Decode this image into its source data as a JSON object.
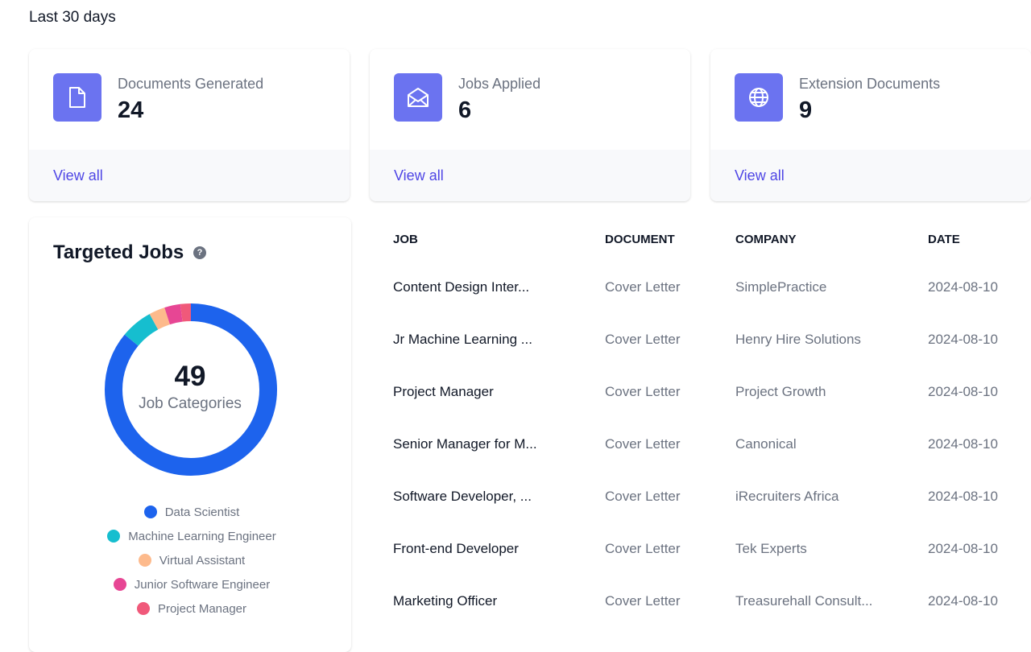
{
  "period": "Last 30 days",
  "stats": [
    {
      "label": "Documents Generated",
      "value": "24",
      "link": "View all",
      "icon": "document-icon"
    },
    {
      "label": "Jobs Applied",
      "value": "6",
      "link": "View all",
      "icon": "envelope-open-icon"
    },
    {
      "label": "Extension Documents",
      "value": "9",
      "link": "View all",
      "icon": "globe-icon"
    }
  ],
  "targeted": {
    "title": "Targeted Jobs",
    "help": "?",
    "center_value": "49",
    "center_label": "Job Categories",
    "categories": [
      {
        "name": "Data Scientist",
        "color": "#1D63ED"
      },
      {
        "name": "Machine Learning Engineer",
        "color": "#16BECF"
      },
      {
        "name": "Virtual Assistant",
        "color": "#FDBA8C"
      },
      {
        "name": "Junior Software Engineer",
        "color": "#E74694"
      },
      {
        "name": "Project Manager",
        "color": "#F0597A"
      }
    ],
    "segment_fractions": [
      0.86,
      0.06,
      0.03,
      0.03,
      0.02
    ]
  },
  "table": {
    "headers": [
      "JOB",
      "DOCUMENT",
      "COMPANY",
      "DATE"
    ],
    "rows": [
      [
        "Content Design Inter...",
        "Cover Letter",
        "SimplePractice",
        "2024-08-10"
      ],
      [
        "Jr Machine Learning ...",
        "Cover Letter",
        "Henry Hire Solutions",
        "2024-08-10"
      ],
      [
        "Project Manager",
        "Cover Letter",
        "Project Growth",
        "2024-08-10"
      ],
      [
        "Senior Manager for M...",
        "Cover Letter",
        "Canonical",
        "2024-08-10"
      ],
      [
        "Software Developer, ...",
        "Cover Letter",
        "iRecruiters Africa",
        "2024-08-10"
      ],
      [
        "Front-end Developer",
        "Cover Letter",
        "Tek Experts",
        "2024-08-10"
      ],
      [
        "Marketing Officer",
        "Cover Letter",
        "Treasurehall Consult...",
        "2024-08-10"
      ]
    ]
  }
}
